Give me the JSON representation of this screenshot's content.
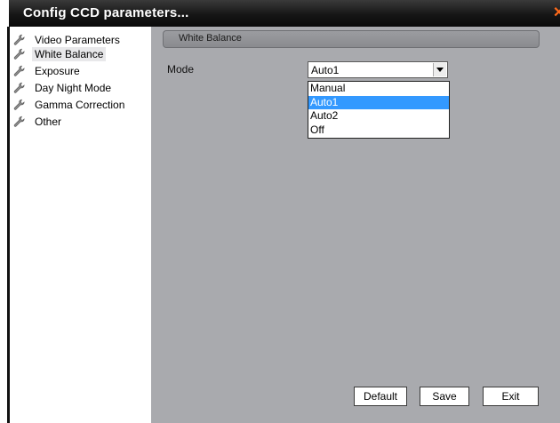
{
  "window": {
    "title": "Config CCD parameters...",
    "close_glyph": "✕"
  },
  "sidebar": {
    "items": [
      {
        "label": "Video Parameters",
        "icon": "wrench-icon"
      },
      {
        "label": "White Balance",
        "icon": "wrench-icon",
        "selected": true
      },
      {
        "label": "Exposure",
        "icon": "wrench-icon"
      },
      {
        "label": "Day Night Mode",
        "icon": "wrench-icon"
      },
      {
        "label": "Gamma Correction",
        "icon": "wrench-icon"
      },
      {
        "label": "Other",
        "icon": "wrench-icon"
      }
    ]
  },
  "panel": {
    "section_title": "White Balance",
    "mode": {
      "label": "Mode",
      "value": "Auto1",
      "options": [
        "Manual",
        "Auto1",
        "Auto2",
        "Off"
      ],
      "highlighted": "Auto1"
    }
  },
  "buttons": {
    "default": "Default",
    "save": "Save",
    "exit": "Exit"
  },
  "colors": {
    "titlebar": "#161616",
    "panel": "#a9aaae",
    "highlight": "#3399ff",
    "close": "#ff6a1a"
  }
}
